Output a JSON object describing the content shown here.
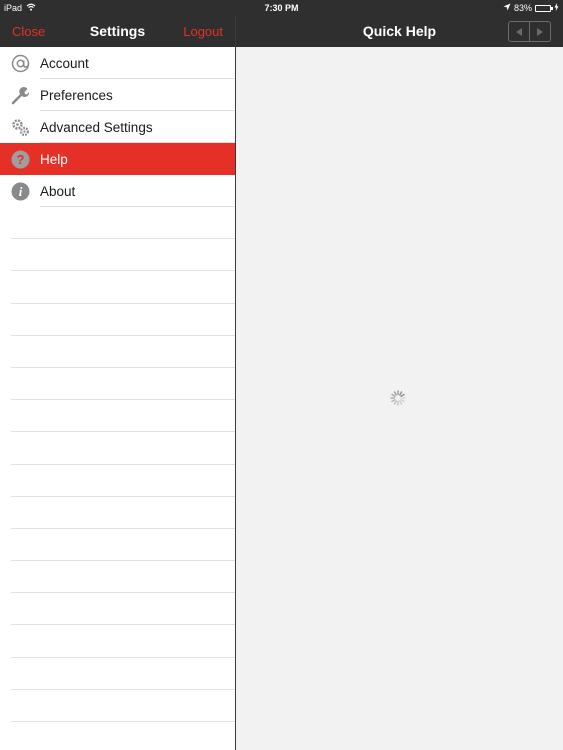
{
  "status_bar": {
    "device": "iPad",
    "time": "7:30 PM",
    "battery": "83%",
    "battery_level": 0.83,
    "icons": [
      "wifi-icon",
      "location-arrow-icon",
      "battery-icon"
    ]
  },
  "settings_panel": {
    "close_label": "Close",
    "title": "Settings",
    "logout_label": "Logout",
    "items": [
      {
        "label": "Account",
        "icon": "at-sign-icon"
      },
      {
        "label": "Preferences",
        "icon": "wrench-icon"
      },
      {
        "label": "Advanced Settings",
        "icon": "gears-icon"
      },
      {
        "label": "Help",
        "icon": "question-circle-icon",
        "selected": true
      },
      {
        "label": "About",
        "icon": "info-circle-icon"
      }
    ]
  },
  "help_panel": {
    "title": "Quick Help",
    "nav_buttons": [
      "back-arrow-icon",
      "forward-arrow-icon"
    ],
    "state": "loading-spinner-icon"
  },
  "colors": {
    "accent": "#e53027",
    "nav_bar": "#2f2f2f",
    "content_background": "#f2f2f2",
    "battery_fill": "#4cd964"
  }
}
